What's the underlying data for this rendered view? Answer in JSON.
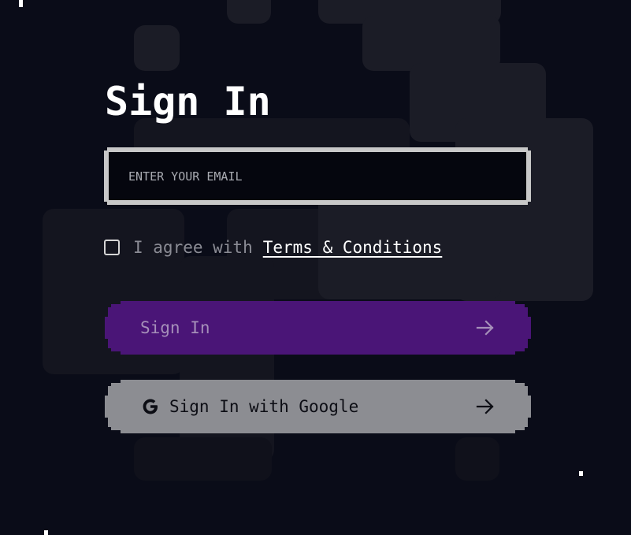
{
  "title": "Sign In",
  "email": {
    "placeholder": "ENTER YOUR EMAIL",
    "value": ""
  },
  "agree": {
    "prefix": "I agree with",
    "link": "Terms & Conditions",
    "checked": false
  },
  "buttons": {
    "signin_label": "Sign In",
    "google_label": "Sign In with Google"
  },
  "icons": {
    "signin_arrow": "arrow-right-icon",
    "google_logo": "google-icon",
    "google_arrow": "arrow-right-icon"
  },
  "colors": {
    "background": "#0a0c18",
    "signin_button": "#4a1577",
    "google_button": "#8c8d92",
    "input_border": "#c8c8c8",
    "text": "#ffffff"
  }
}
